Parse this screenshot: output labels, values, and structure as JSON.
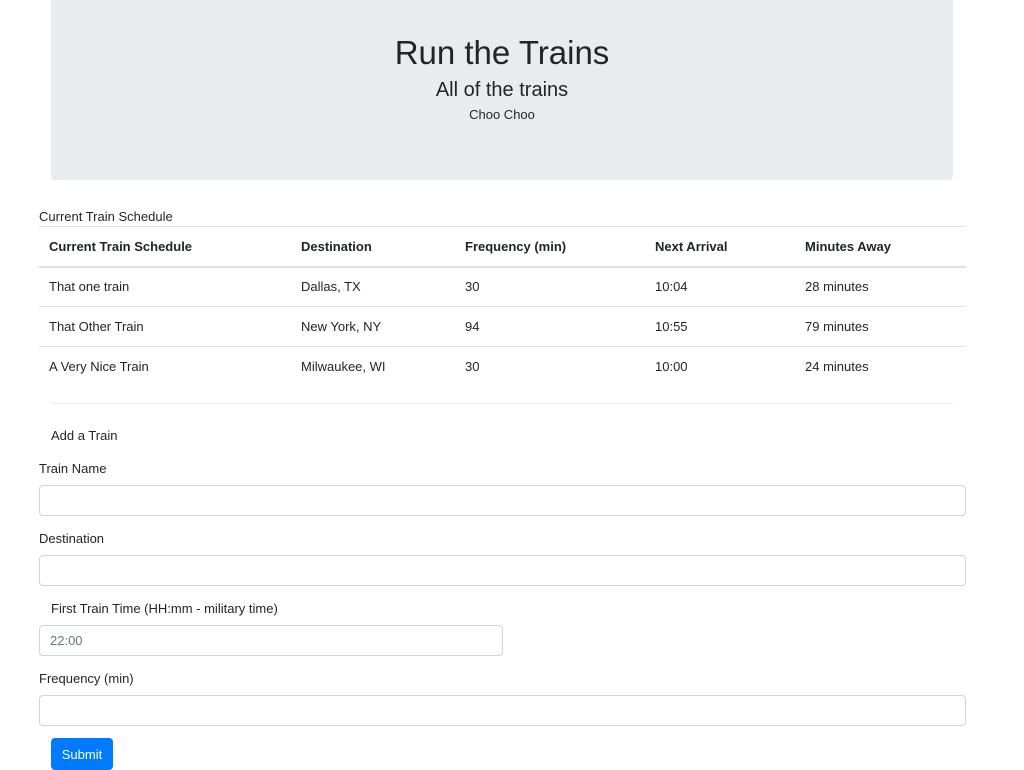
{
  "header": {
    "title": "Run the Trains",
    "subtitle": "All of the trains",
    "tagline": "Choo Choo"
  },
  "schedule": {
    "caption": "Current Train Schedule",
    "columns": [
      "Current Train Schedule",
      "Destination",
      "Frequency (min)",
      "Next Arrival",
      "Minutes Away"
    ],
    "rows": [
      [
        "That one train",
        "Dallas, TX",
        "30",
        "10:04",
        "28 minutes"
      ],
      [
        "That Other Train",
        "New York, NY",
        "94",
        "10:55",
        "79 minutes"
      ],
      [
        "A Very Nice Train",
        "Milwaukee, WI",
        "30",
        "10:00",
        "24 minutes"
      ]
    ]
  },
  "form": {
    "heading": "Add a Train",
    "train_name": {
      "label": "Train Name",
      "value": ""
    },
    "destination": {
      "label": "Destination",
      "value": ""
    },
    "first_time": {
      "label": "First Train Time (HH:mm - military time)",
      "placeholder": "22:00"
    },
    "frequency": {
      "label": "Frequency (min)",
      "value": ""
    },
    "submit_label": "Submit"
  }
}
